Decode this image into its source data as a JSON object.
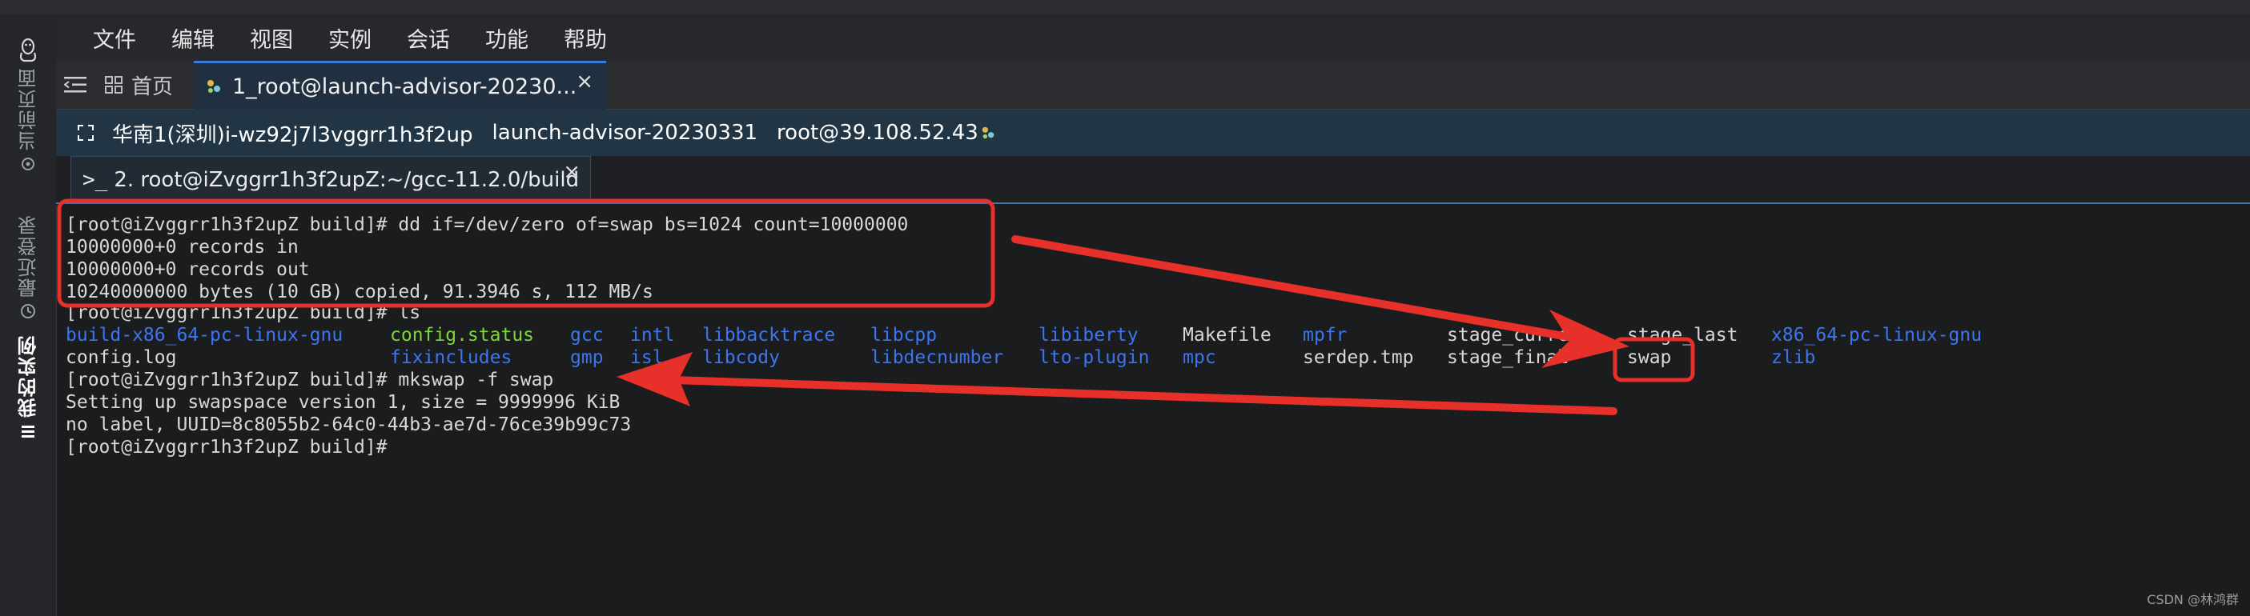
{
  "menubar": {
    "items": [
      "文件",
      "编辑",
      "视图",
      "实例",
      "会话",
      "功能",
      "帮助"
    ]
  },
  "sidebar": {
    "items": [
      {
        "label": "当前页面",
        "icon": "gear-icon"
      },
      {
        "label": "最近登录",
        "icon": "clock-icon"
      },
      {
        "label": "我的实例",
        "icon": "list-icon"
      }
    ]
  },
  "tabs": {
    "home": "首页",
    "session": "1_root@launch-advisor-20230...",
    "close": "×"
  },
  "infobar": {
    "region_instance": "华南1(深圳)i-wz92j7l3vggrr1h3f2up",
    "instance_name": "launch-advisor-20230331",
    "login": "root@39.108.52.43"
  },
  "terminal_tab": {
    "label": "2. root@iZvggrr1h3f2upZ:~/gcc-11.2.0/build",
    "close": "×"
  },
  "terminal": {
    "cmd_dd": "[root@iZvggrr1h3f2upZ build]# dd if=/dev/zero of=swap bs=1024 count=10000000",
    "rec_in": "10000000+0 records in",
    "rec_out": "10000000+0 records out",
    "bytes": "10240000000 bytes (10 GB) copied, 91.3946 s, 112 MB/s",
    "cmd_ls": "[root@iZvggrr1h3f2upZ build]# ls",
    "ls_row1": [
      "build-x86_64-pc-linux-gnu",
      "config.status",
      "gcc",
      "intl",
      "libbacktrace",
      "libcpp",
      "libiberty",
      "Makefile",
      "mpfr",
      "stage_current",
      "stage_last",
      "x86_64-pc-linux-gnu"
    ],
    "ls_row2": [
      "config.log",
      "fixincludes",
      "gmp",
      "isl",
      "libcody",
      "libdecnumber",
      "lto-plugin",
      "mpc",
      "serdep.tmp",
      "stage_final",
      "swap",
      "zlib"
    ],
    "cmd_mkswap": "[root@iZvggrr1h3f2upZ build]# mkswap -f swap",
    "setup": "Setting up swapspace version 1, size = 9999996 KiB",
    "uuid": "no label, UUID=8c8055b2-64c0-44b3-ae7d-76ce39b99c73",
    "prompt": "[root@iZvggrr1h3f2upZ build]#"
  },
  "colors": {
    "annotation": "#e8302a",
    "dir_blue": "#3b76f0",
    "exec_green": "#7dd63a",
    "accent_tab": "#3a7bd5"
  },
  "watermark": "CSDN @林鸿群"
}
